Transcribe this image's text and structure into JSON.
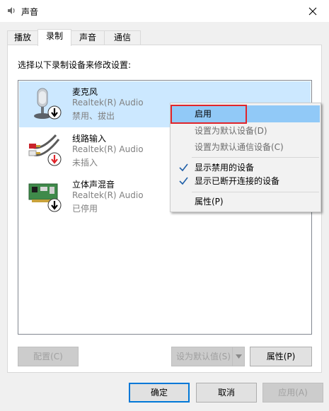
{
  "window": {
    "title": "声音"
  },
  "tabs": [
    {
      "label": "播放"
    },
    {
      "label": "录制"
    },
    {
      "label": "声音"
    },
    {
      "label": "通信"
    }
  ],
  "panel": {
    "instruction": "选择以下录制设备来修改设置:"
  },
  "devices": [
    {
      "name": "麦克风",
      "driver": "Realtek(R) Audio",
      "status": "禁用、拔出"
    },
    {
      "name": "线路输入",
      "driver": "Realtek(R) Audio",
      "status": "未插入"
    },
    {
      "name": "立体声混音",
      "driver": "Realtek(R) Audio",
      "status": "已停用"
    }
  ],
  "context_menu": {
    "enable": "启用",
    "set_default": "设置为默认设备(D)",
    "set_default_comm": "设置为默认通信设备(C)",
    "show_disabled": "显示禁用的设备",
    "show_disconnected": "显示已断开连接的设备",
    "properties": "属性(P)"
  },
  "buttons": {
    "configure": "配置(C)",
    "set_default": "设为默认值(S)",
    "properties": "属性(P)",
    "ok": "确定",
    "cancel": "取消",
    "apply": "应用(A)"
  },
  "colors": {
    "selection": "#cce8ff",
    "menu_highlight": "#91c9f7",
    "annotation": "#e0242a",
    "accent": "#0078d7"
  }
}
